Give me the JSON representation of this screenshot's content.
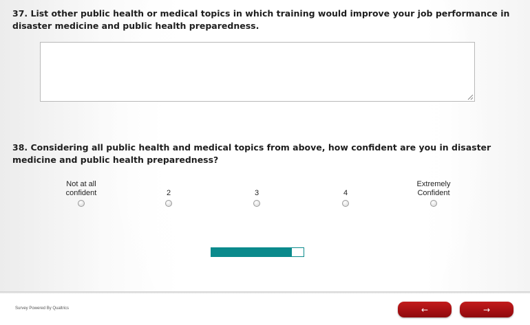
{
  "questions": {
    "q37": {
      "text": "37. List other public health or medical topics in which training would improve your job performance in disaster medicine and public health preparedness.",
      "answer_value": ""
    },
    "q38": {
      "text": "38. Considering all public health and medical topics from above, how confident are you in disaster medicine and public health preparedness?",
      "scale": [
        {
          "label": "Not at all confident",
          "selected": false
        },
        {
          "label": "2",
          "selected": false
        },
        {
          "label": "3",
          "selected": false
        },
        {
          "label": "4",
          "selected": false
        },
        {
          "label": "Extremely Confident",
          "selected": false
        }
      ]
    }
  },
  "progress": {
    "fraction": 0.87,
    "color": "#0b8a8c"
  },
  "footer": {
    "powered_by": "Survey Powered By Qualtrics",
    "back_label": "←",
    "next_label": "→"
  },
  "colors": {
    "nav_button": "#a40f12",
    "accent": "#0b8a8c"
  },
  "icons": {
    "back": "left-arrow-icon",
    "next": "right-arrow-icon",
    "grip": "resize-grip-icon"
  }
}
